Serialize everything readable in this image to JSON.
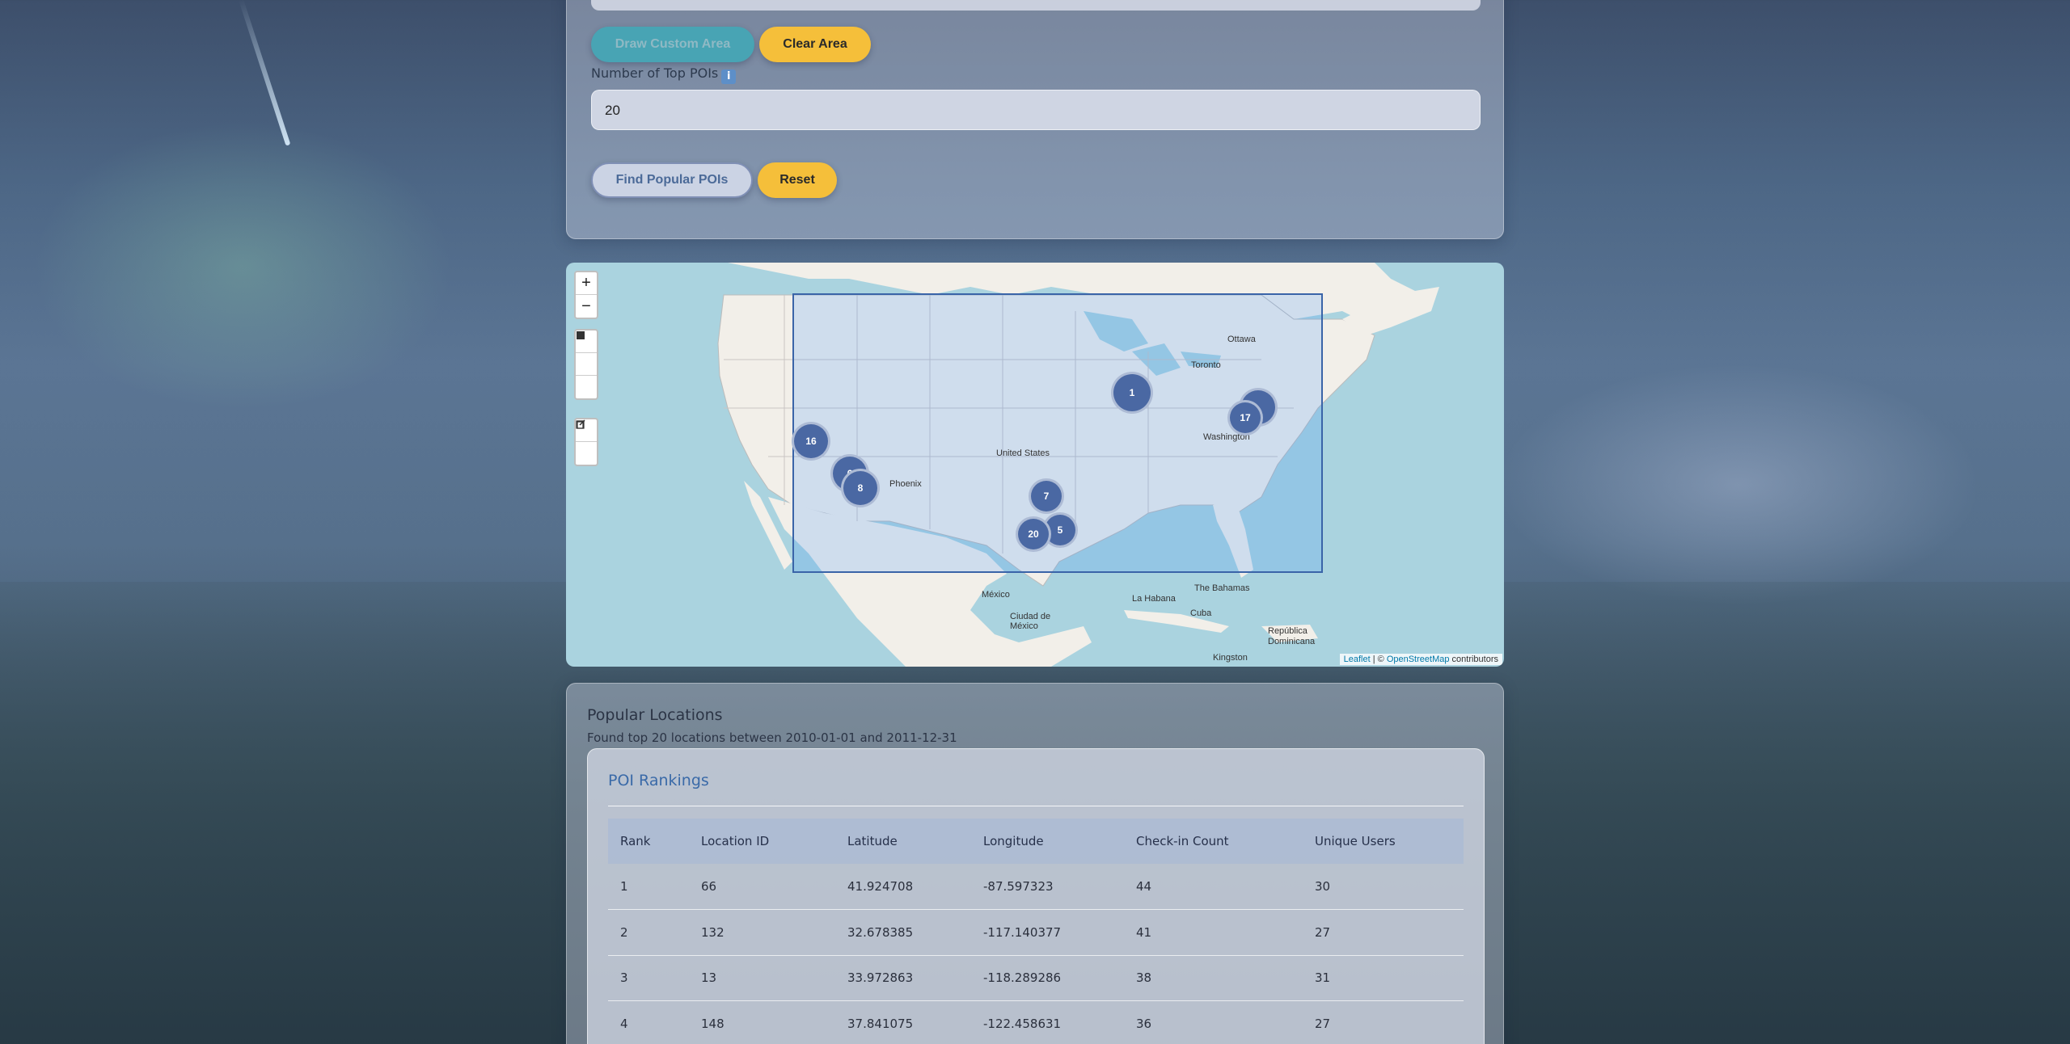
{
  "controls": {
    "draw_custom_area_label": "Draw Custom Area",
    "clear_area_label": "Clear Area",
    "top_pois_label": "Number of Top POIs",
    "info_icon": "info-icon",
    "top_pois_value": "20",
    "find_label": "Find Popular POIs",
    "reset_label": "Reset"
  },
  "map": {
    "zoom_in": "+",
    "zoom_out": "−",
    "draw_tools": [
      "polygon-icon",
      "rectangle-icon",
      "circle-icon",
      "edit-icon",
      "trash-icon"
    ],
    "clusters": [
      {
        "label": "1"
      },
      {
        "label": "17"
      },
      {
        "label": "16"
      },
      {
        "label": "6"
      },
      {
        "label": "8"
      },
      {
        "label": "7"
      },
      {
        "label": "20"
      },
      {
        "label": "5"
      }
    ],
    "place_labels": [
      "Ottawa",
      "Toronto",
      "Washington",
      "United States",
      "Phoenix",
      "México",
      "Ciudad de México",
      "La Habana",
      "Cuba",
      "The Bahamas",
      "República Dominicana",
      "Kingston"
    ],
    "attribution_leaflet": "Leaflet",
    "attribution_sep": " | © ",
    "attribution_osm": "OpenStreetMap",
    "attribution_contrib": " contributors"
  },
  "results": {
    "title": "Popular Locations",
    "subtitle": "Found top 20 locations between 2010-01-01 and 2011-12-31",
    "card_title": "POI Rankings",
    "columns": [
      "Rank",
      "Location ID",
      "Latitude",
      "Longitude",
      "Check-in Count",
      "Unique Users"
    ],
    "rows": [
      [
        "1",
        "66",
        "41.924708",
        "-87.597323",
        "44",
        "30"
      ],
      [
        "2",
        "132",
        "32.678385",
        "-117.140377",
        "41",
        "27"
      ],
      [
        "3",
        "13",
        "33.972863",
        "-118.289286",
        "38",
        "31"
      ],
      [
        "4",
        "148",
        "37.841075",
        "-122.458631",
        "36",
        "27"
      ]
    ]
  }
}
